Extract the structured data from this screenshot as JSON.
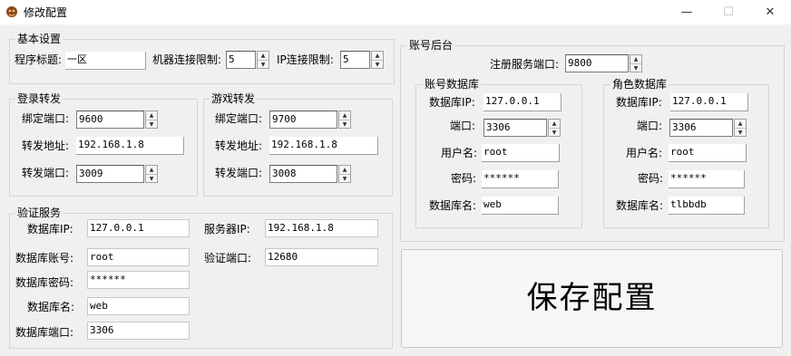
{
  "window": {
    "title": "修改配置",
    "minimize": "—",
    "maximize": "☐",
    "close": "✕"
  },
  "basic": {
    "legend": "基本设置",
    "program_title_label": "程序标题:",
    "program_title_value": "一区",
    "machine_limit_label": "机器连接限制:",
    "machine_limit_value": "5",
    "ip_limit_label": "IP连接限制:",
    "ip_limit_value": "5"
  },
  "login_forward": {
    "legend": "登录转发",
    "bind_port_label": "绑定端口:",
    "bind_port_value": "9600",
    "forward_addr_label": "转发地址:",
    "forward_addr_value": "192.168.1.8",
    "forward_port_label": "转发端口:",
    "forward_port_value": "3009"
  },
  "game_forward": {
    "legend": "游戏转发",
    "bind_port_label": "绑定端口:",
    "bind_port_value": "9700",
    "forward_addr_label": "转发地址:",
    "forward_addr_value": "192.168.1.8",
    "forward_port_label": "转发端口:",
    "forward_port_value": "3008"
  },
  "verify": {
    "legend": "验证服务",
    "db_ip_label": "数据库IP:",
    "db_ip_value": "127.0.0.1",
    "db_account_label": "数据库账号:",
    "db_account_value": "root",
    "db_password_label": "数据库密码:",
    "db_password_value": "******",
    "db_name_label": "数据库名:",
    "db_name_value": "web",
    "db_port_label": "数据库端口:",
    "db_port_value": "3306",
    "server_ip_label": "服务器IP:",
    "server_ip_value": "192.168.1.8",
    "verify_port_label": "验证端口:",
    "verify_port_value": "12680"
  },
  "account": {
    "legend": "账号后台",
    "register_port_label": "注册服务端口:",
    "register_port_value": "9800",
    "account_db": {
      "legend": "账号数据库",
      "ip_label": "数据库IP:",
      "ip_value": "127.0.0.1",
      "port_label": "端口:",
      "port_value": "3306",
      "user_label": "用户名:",
      "user_value": "root",
      "password_label": "密码:",
      "password_value": "******",
      "name_label": "数据库名:",
      "name_value": "web"
    },
    "role_db": {
      "legend": "角色数据库",
      "ip_label": "数据库IP:",
      "ip_value": "127.0.0.1",
      "port_label": "端口:",
      "port_value": "3306",
      "user_label": "用户名:",
      "user_value": "root",
      "password_label": "密码:",
      "password_value": "******",
      "name_label": "数据库名:",
      "name_value": "tlbbdb"
    }
  },
  "save_button": "保存配置",
  "icons": {
    "app": "app-icon",
    "spin_up": "▲",
    "spin_down": "▼"
  }
}
